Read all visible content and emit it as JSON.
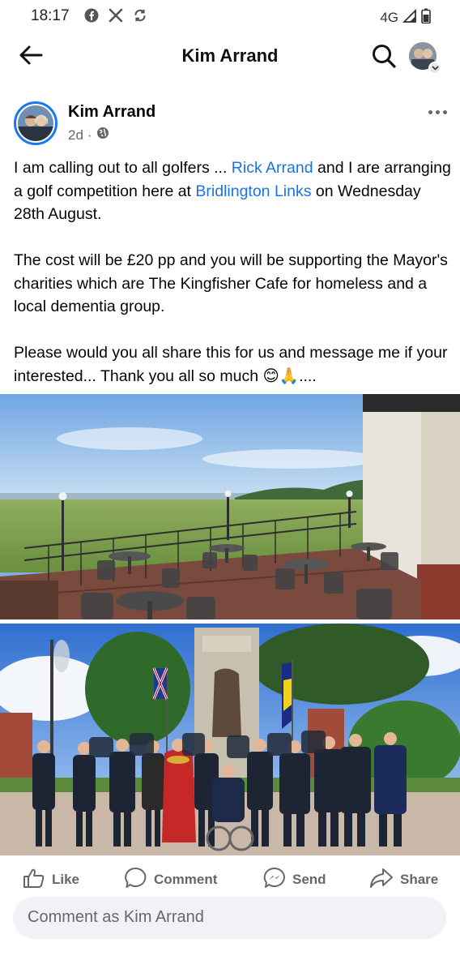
{
  "status_bar": {
    "time": "18:17",
    "network": "4G",
    "icons_left": [
      "facebook-icon",
      "x-icon",
      "sync-icon"
    ],
    "icons_right": [
      "signal-icon",
      "battery-icon"
    ]
  },
  "app_bar": {
    "title": "Kim Arrand",
    "back_icon": "arrow-left-icon",
    "search_icon": "search-icon"
  },
  "post": {
    "author": "Kim Arrand",
    "time_ago": "2d",
    "separator": "·",
    "privacy_icon": "globe-icon",
    "paragraphs": {
      "p1_a": "I am calling out to all golfers ... ",
      "p1_link1": "Rick Arrand",
      "p1_b": " and I are arranging a golf competition here at ",
      "p1_link2": "Bridlington Links",
      "p1_c": " on Wednesday 28th August.",
      "p2": "The cost will be £20 pp and you will be supporting the Mayor's charities which are The Kingfisher Cafe for homeless and a local dementia group.",
      "p3": "Please would you all share this for us and message me if your interested... Thank you all so much 😊🙏...."
    },
    "photos": [
      {
        "subject": "golf-club-terrace-photo"
      },
      {
        "subject": "war-memorial-group-photo"
      }
    ]
  },
  "actions": {
    "like": "Like",
    "comment": "Comment",
    "send": "Send",
    "share": "Share"
  },
  "comment_bar": {
    "placeholder": "Comment as Kim Arrand"
  },
  "colors": {
    "link": "#1b74e4",
    "secondary_text": "#65676b",
    "avatar_ring": "#1877f2",
    "input_bg": "#f0f2f5"
  }
}
